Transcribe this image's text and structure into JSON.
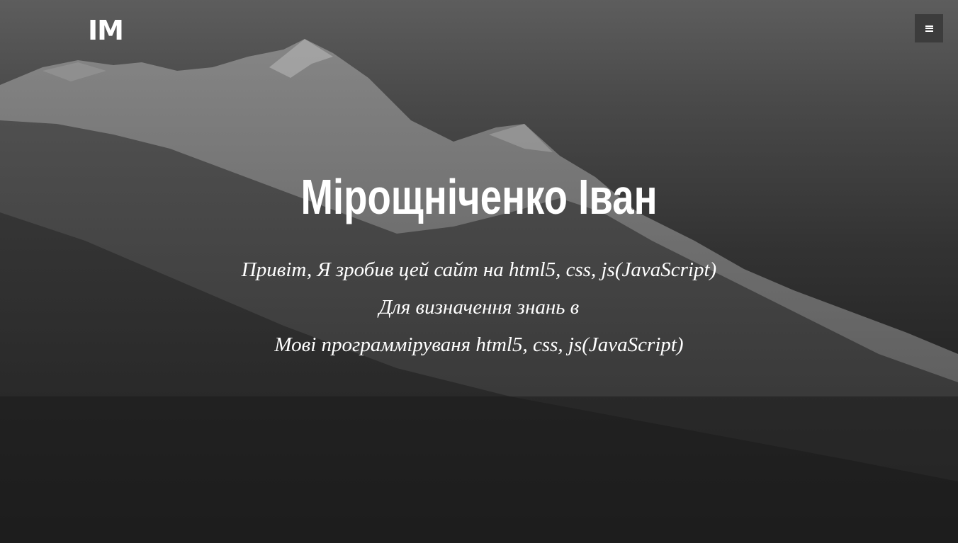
{
  "header": {
    "logo_text": "IM",
    "menu_icon": "hamburger-menu-icon"
  },
  "hero": {
    "background": "mountain-landscape-grayscale",
    "title": "Мірощніченко Іван",
    "lines": [
      "Привіт, Я зробив цей сайт на html5, css, js(JavaScript)",
      "Для визначення знань в",
      "Мові программіруваня html5, css, js(JavaScript)"
    ]
  },
  "colors": {
    "text": "#ffffff",
    "menu_button_bg": "#3c3c3c",
    "sky_top": "#5d5d5d",
    "ground": "#1f1f1f"
  }
}
